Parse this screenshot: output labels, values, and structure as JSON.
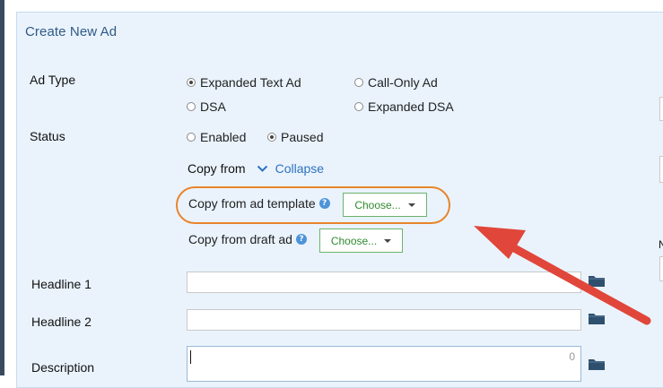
{
  "page": {
    "title": "Create New Ad"
  },
  "form": {
    "ad_type": {
      "label": "Ad Type",
      "options": [
        {
          "label": "Expanded Text Ad",
          "selected": true
        },
        {
          "label": "Call-Only Ad",
          "selected": false
        },
        {
          "label": "DSA",
          "selected": false
        },
        {
          "label": "Expanded DSA",
          "selected": false
        }
      ]
    },
    "status": {
      "label": "Status",
      "options": [
        {
          "label": "Enabled",
          "selected": false
        },
        {
          "label": "Paused",
          "selected": true
        }
      ]
    },
    "copy_from": {
      "label": "Copy from",
      "toggle_label": "Collapse",
      "template": {
        "label": "Copy from ad template",
        "button_label": "Choose..."
      },
      "draft": {
        "label": "Copy from draft ad",
        "button_label": "Choose..."
      }
    },
    "headline1": {
      "label": "Headline 1",
      "value": ""
    },
    "headline2": {
      "label": "Headline 2",
      "value": ""
    },
    "description": {
      "label": "Description",
      "value": "",
      "char_count": "0"
    }
  },
  "edge": {
    "partial_label": "N"
  },
  "annotation": {
    "highlight_color": "#e8852c",
    "arrow_color": "#e0463a"
  },
  "colors": {
    "panel_bg": "#eaf3fc",
    "title": "#2f5a86",
    "link": "#2d72c0",
    "choose_border": "#6bb36b",
    "choose_text": "#2f8a2f",
    "folder": "#2f4f6f",
    "help": "#4d93d9"
  }
}
